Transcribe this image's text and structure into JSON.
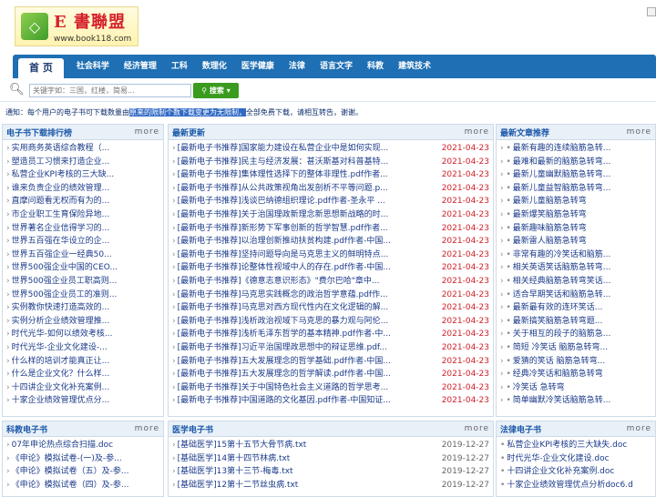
{
  "header": {
    "logo_cn": "E 書聯盟",
    "logo_url": "www.book118.com"
  },
  "nav": {
    "items": [
      "首 页",
      "社会科学",
      "经济管理",
      "工科",
      "数理化",
      "医学健康",
      "法律",
      "语言文字",
      "科教",
      "建筑技术"
    ]
  },
  "search": {
    "placeholder": "关键字如：三国，红楼，简易...",
    "button": "搜索"
  },
  "notice": {
    "prefix": "通知：每个用户的电子书可下载数量由",
    "highlight": "原来的限制个数下载变更为无限制，",
    "suffix": "全部免费下载，请相互转告，谢谢。"
  },
  "colors": {
    "nav": "#1e6fb3",
    "accent_red": "#d0202a",
    "link": "#1a3a8a"
  },
  "panels": {
    "ranking": {
      "title": "电子书下载排行榜",
      "more": "more",
      "items": [
        "实用商务英语综合教程（...",
        "塑造员工习惯来打造企业...",
        "私营企业KPI考核的三大缺...",
        "谁来负责企业的绩效管理...",
        "直摩问题看无权而有为的...",
        "市企业职工生育保险异地...",
        "世界著名企业信得学习的...",
        "世界五百强在华设立的企...",
        "世界五百强企业一经典50...",
        "世界500强企业中国的CEO...",
        "世界500强企业员工职高则...",
        "世界500强企业员工的准则...",
        "实例教你快速打造高效的...",
        "实例分析企业绩效管理推...",
        "时代光华-如何以绩效考核...",
        "时代光华-企业文化建设-...",
        "什么样的培训才能真正让...",
        "什么是企业文化？什么样...",
        "十四讲企业文化补充案例...",
        "十家企业绩效管理优点分..."
      ]
    },
    "latest": {
      "title": "最新更新",
      "more": "more",
      "items": [
        {
          "t": "[最新电子书推荐]国家能力建设在私营企业中是如何实现...",
          "d": "2021-04-23"
        },
        {
          "t": "[最新电子书推荐]民主与经济发展：甚沃斯基对科普基特...",
          "d": "2021-04-23"
        },
        {
          "t": "[最新电子书推荐]集体理性选择下的整体非理性.pdf作者...",
          "d": "2021-04-23"
        },
        {
          "t": "[最新电子书推荐]从公共政策视角出发剖析不平等问题.p...",
          "d": "2021-04-23"
        },
        {
          "t": "[最新电子书推荐]浅谈巴纳德组织理论.pdf作者-圣永平 ...",
          "d": "2021-04-23"
        },
        {
          "t": "[最新电子书推荐]关于治国理政新理念新思想新战略的时...",
          "d": "2021-04-23"
        },
        {
          "t": "[最新电子书推荐]新形势下军事创新的哲学智慧.pdf作者...",
          "d": "2021-04-23"
        },
        {
          "t": "[最新电子书推荐]以治理创新推动扶贫构建.pdf作者-中国...",
          "d": "2021-04-23"
        },
        {
          "t": "[最新电子书推荐]坚持问题导向是马克思主义的鲜明特点...",
          "d": "2021-04-23"
        },
        {
          "t": "[最新电子书推荐]论整体性视域中人的存在.pdf作者-中国...",
          "d": "2021-04-23"
        },
        {
          "t": "[最新电子书推荐]《德意志意识形态》\"费尔巴哈\"章中...",
          "d": "2021-04-23"
        },
        {
          "t": "[最新电子书推荐]马克思实践概念的政治哲学意蕴.pdf作...",
          "d": "2021-04-23"
        },
        {
          "t": "[最新电子书推荐]马克思对西方现代性内在文化逻辑的解...",
          "d": "2021-04-23"
        },
        {
          "t": "[最新电子书推荐]浅析政治视域下马克思的暴力观与阿伦...",
          "d": "2021-04-23"
        },
        {
          "t": "[最新电子书推荐]浅析毛泽东哲学的基本精神.pdf作者-中...",
          "d": "2021-04-23"
        },
        {
          "t": "[最新电子书推荐]习近平治国理政思想中的辩证思维.pdf...",
          "d": "2021-04-23"
        },
        {
          "t": "[最新电子书推荐]五大发展理念的哲学基础.pdf作者-中国...",
          "d": "2021-04-23"
        },
        {
          "t": "[最新电子书推荐]五大发展理念的哲学解读.pdf作者-中国...",
          "d": "2021-04-23"
        },
        {
          "t": "[最新电子书推荐]关于中国特色社会主义道路的哲学思考...",
          "d": "2021-04-23"
        },
        {
          "t": "[最新电子书推荐]中国道路的文化基因.pdf作者-中国知证...",
          "d": "2021-04-23"
        }
      ]
    },
    "articles": {
      "title": "最新文章推荐",
      "more": "more",
      "items": [
        "最新有趣的连续脑筋急转...",
        "最难和最新的脑筋急转弯...",
        "最新儿童幽默脑筋急转弯...",
        "最新儿童益智脑筋急转弯...",
        "最新儿童脑筋急转弯",
        "最新爆笑脑筋急转弯",
        "最新趣味脑筋急转弯",
        "最新雷人脑筋急转弯",
        "非常有趣的冷笑话和脑筋...",
        "相关英语笑话脑筋急转弯...",
        "相关经典脑筋急转弯笑话...",
        "适合早期笑话和脑筋急转...",
        "最新最有效的连环笑话...",
        "最新搞笑脑筋急转弯题...",
        "关于相互的段子的脑筋急...",
        "简短 冷笑话 脑筋急转弯...",
        "爱猜的笑话 脑筋急转弯...",
        "经典冷笑话和脑筋急转弯",
        "冷笑话 急转弯",
        "简单幽默冷笑话脑筋急转..."
      ]
    },
    "science": {
      "title": "科教电子书",
      "more": "more",
      "items": [
        "07年申论热点综合扫描.doc",
        "《申论》模拟试卷-(一)及-参...",
        "《申论》模拟试卷（五）及-参...",
        "《申论》模拟试卷（四）及-参..."
      ]
    },
    "medical": {
      "title": "医学电子书",
      "more": "more",
      "items": [
        {
          "t": "[基础医学]15第十五节大骨节病.txt",
          "d": "2019-12-27"
        },
        {
          "t": "[基础医学]14第十四节林病.txt",
          "d": "2019-12-27"
        },
        {
          "t": "[基础医学]13第十三节-梅毒.txt",
          "d": "2019-12-27"
        },
        {
          "t": "[基础医学]12第十二节丝虫病.txt",
          "d": "2019-12-27"
        }
      ]
    },
    "law": {
      "title": "法律电子书",
      "more": "more",
      "items": [
        "私营企业KPI考核的三大缺失.doc",
        "时代光华-企业文化建设.doc",
        "十四讲企业文化补充案例.doc",
        "十家企业绩效管理优点分析doc6.d"
      ]
    }
  }
}
